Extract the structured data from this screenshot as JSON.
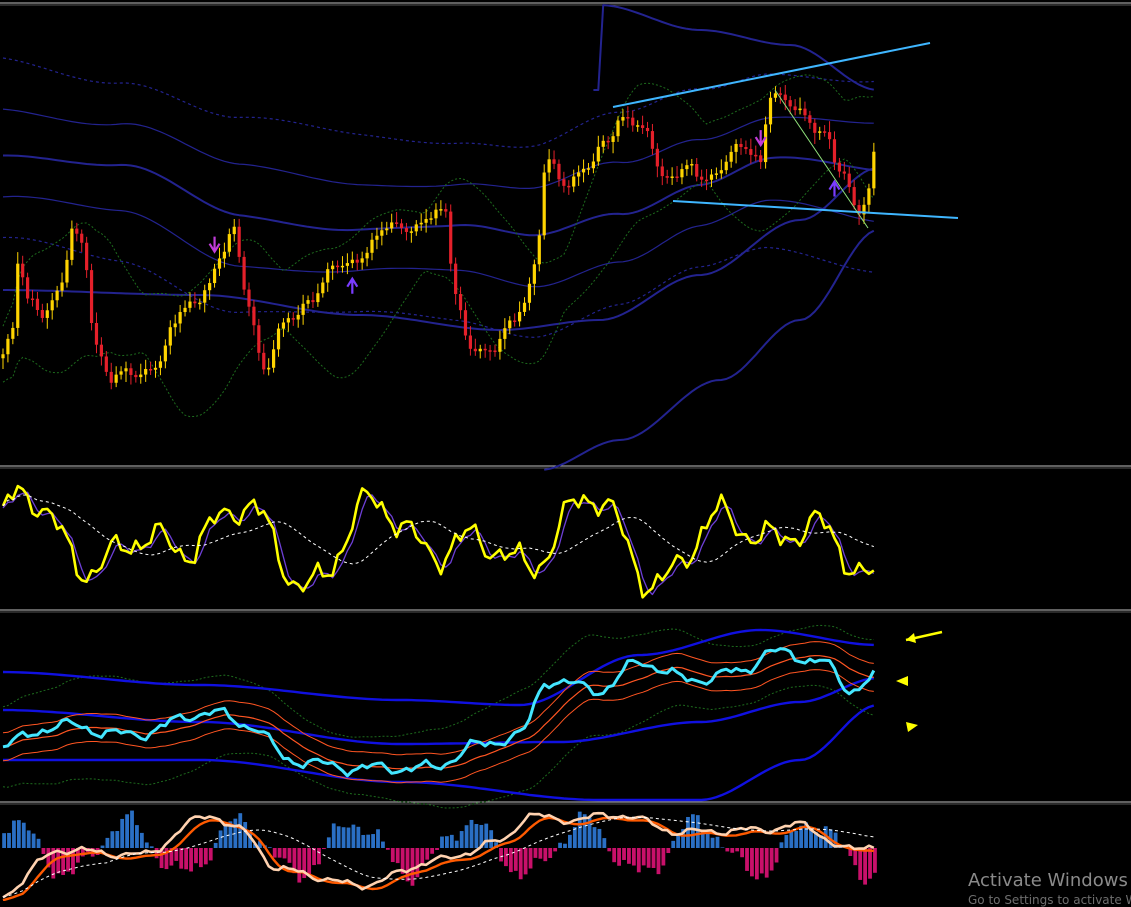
{
  "watermark": {
    "title": "Activate Windows",
    "subtitle": "Go to Settings to activate Windows."
  },
  "colors": {
    "background": "#000000",
    "separator": "#c0c0c0",
    "candle_up": "#ffd400",
    "candle_down": "#e4202a",
    "band_navy": "#23238f",
    "band_green": "#1d6b1d",
    "trendline": "#3fb6ff",
    "fractal_up": "#7a3cff",
    "fractal_down": "#c03cd8",
    "oscillator_main": "#ffff00",
    "oscillator_signal": "#6d3fd6",
    "oscillator_ma": "#ffffff",
    "cyan_line": "#44e6ff",
    "blue_band": "#1010e0",
    "red_band": "#ff5522",
    "hist_pos": "#2a6fc4",
    "hist_neg": "#c8106a",
    "macd_main": "#ffd2b0",
    "macd_signal": "#ff5a00",
    "arrow_yellow": "#ffff00"
  },
  "chart_data": [
    {
      "panel": "price",
      "type": "candlestick",
      "candles": 178,
      "overlays": [
        "bollinger_bands_green",
        "envelope_bands_navy",
        "trend_channel"
      ],
      "trendlines": [
        {
          "name": "upper",
          "description": "rising resistance"
        },
        {
          "name": "lower",
          "description": "support"
        }
      ],
      "fractals": [
        {
          "type": "down",
          "index": 43
        },
        {
          "type": "up",
          "index": 71
        },
        {
          "type": "down",
          "index": 154
        },
        {
          "type": "up",
          "index": 169
        }
      ]
    },
    {
      "panel": "oscillator",
      "type": "line",
      "series": [
        {
          "role": "main"
        },
        {
          "role": "signal"
        },
        {
          "role": "moving_average"
        }
      ],
      "ylim": [
        0,
        100
      ]
    },
    {
      "panel": "bands",
      "type": "line",
      "series": [
        {
          "role": "main"
        },
        {
          "role": "blue_bands"
        },
        {
          "role": "red_bands"
        },
        {
          "role": "green_bands"
        }
      ],
      "markers": [
        "arrow",
        "triangle",
        "triangle"
      ]
    },
    {
      "panel": "histogram",
      "type": "bar",
      "series": [
        {
          "role": "histogram"
        },
        {
          "role": "main"
        },
        {
          "role": "signal"
        },
        {
          "role": "moving_average"
        }
      ]
    }
  ]
}
